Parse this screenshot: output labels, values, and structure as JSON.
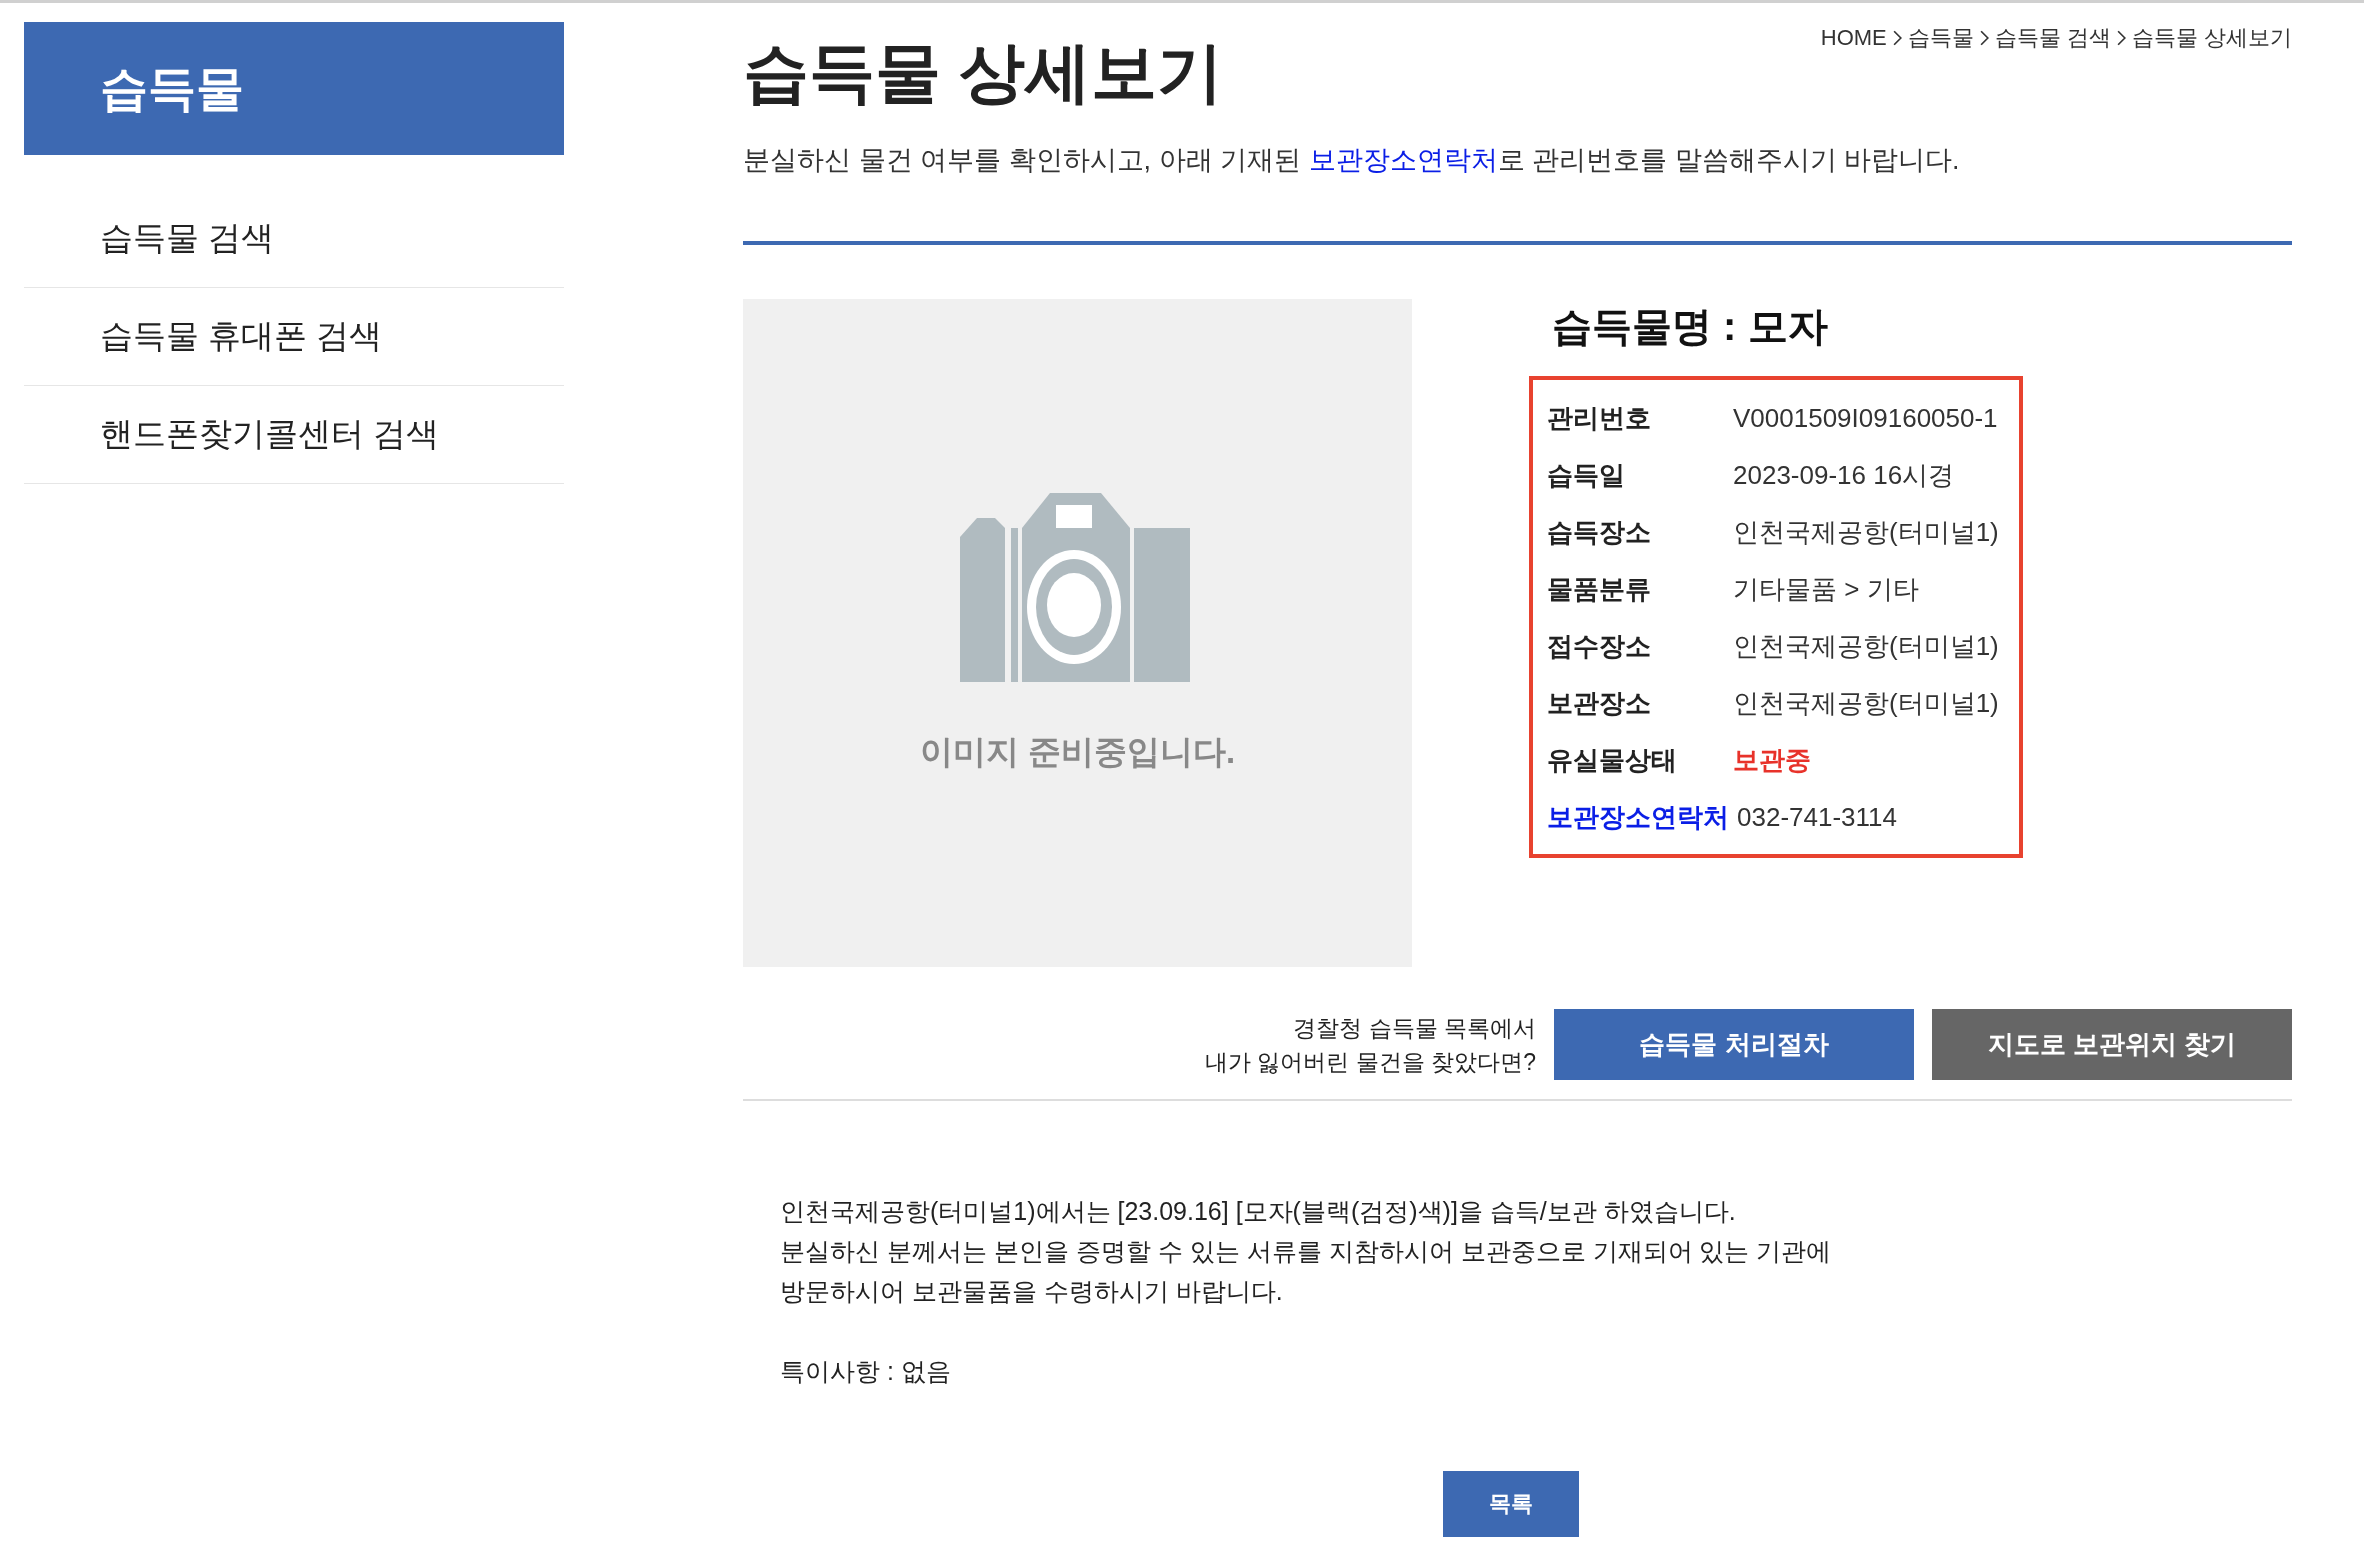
{
  "sidebar": {
    "title": "습득물",
    "items": [
      "습득물 검색",
      "습득물 휴대폰 검색",
      "핸드폰찾기콜센터 검색"
    ]
  },
  "breadcrumb": [
    "HOME",
    "습득물",
    "습득물 검색",
    "습득물 상세보기"
  ],
  "page_title": "습득물 상세보기",
  "notice": {
    "before": "분실하신 물건 여부를 확인하시고, 아래 기재된 ",
    "link": "보관장소연락처",
    "after": "로 관리번호를 말씀해주시기 바랍니다."
  },
  "image": {
    "caption": "이미지 준비중입니다."
  },
  "item_title": "습득물명 : 모자",
  "details": [
    {
      "label": "관리번호",
      "value": "V0001509I09160050-1",
      "kind": "plain"
    },
    {
      "label": "습득일",
      "value": "2023-09-16 16시경",
      "kind": "plain"
    },
    {
      "label": "습득장소",
      "value": "인천국제공항(터미널1)",
      "kind": "plain"
    },
    {
      "label": "물품분류",
      "value": "기타물품 > 기타",
      "kind": "plain"
    },
    {
      "label": "접수장소",
      "value": "인천국제공항(터미널1)",
      "kind": "plain"
    },
    {
      "label": "보관장소",
      "value": "인천국제공항(터미널1)",
      "kind": "plain"
    },
    {
      "label": "유실물상태",
      "value": "보관중",
      "kind": "status"
    },
    {
      "label": "보관장소연락처",
      "value": "032-741-3114",
      "kind": "contact"
    }
  ],
  "prompt": [
    "경찰청 습득물 목록에서",
    "내가 잃어버린 물건을 찾았다면?"
  ],
  "buttons": [
    {
      "label": "습득물 처리절차",
      "kind": "primary"
    },
    {
      "label": "지도로 보관위치 찾기",
      "kind": "secondary"
    }
  ],
  "description": {
    "lines": [
      "인천국제공항(터미널1)에서는 [23.09.16] [모자(블랙(검정)색)]을 습득/보관 하였습니다.",
      "분실하신 분께서는 본인을 증명할 수 있는 서류를 지참하시어 보관중으로 기재되어 있는 기관에",
      "방문하시어 보관물품을 수령하시기 바랍니다."
    ],
    "note": "특이사항 : 없음"
  },
  "list_button": "목록"
}
